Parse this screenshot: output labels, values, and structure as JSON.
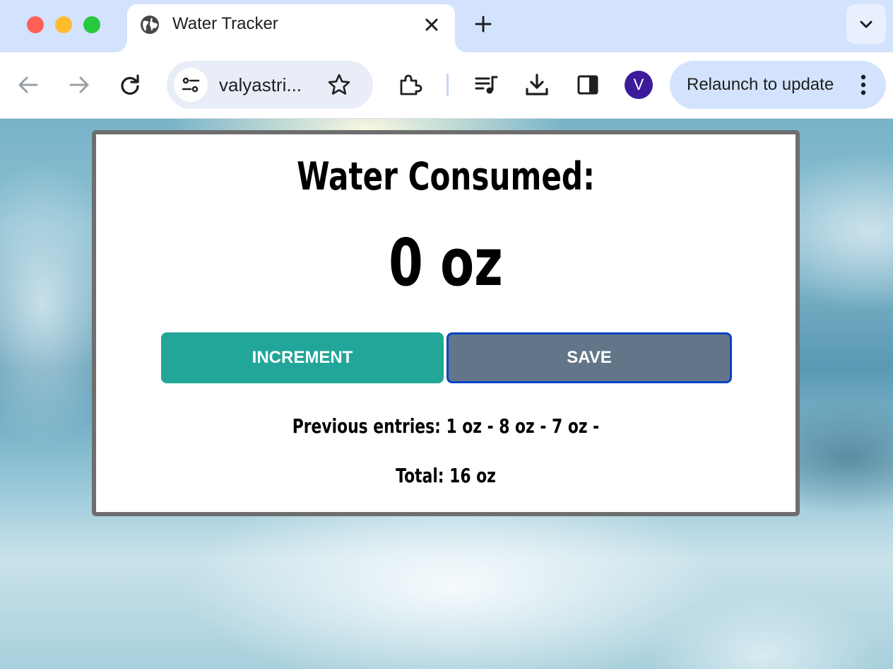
{
  "browser": {
    "tab": {
      "title": "Water Tracker",
      "icon": "globe-icon"
    },
    "omnibox": {
      "url": "valyastri..."
    },
    "profile_initial": "V",
    "relaunch_label": "Relaunch to update"
  },
  "app": {
    "heading": "Water Consumed:",
    "amount": "0 oz",
    "buttons": {
      "increment": "INCREMENT",
      "save": "SAVE"
    },
    "previous_entries": "Previous entries: 1 oz - 8 oz - 7 oz -",
    "total": "Total: 16 oz"
  },
  "colors": {
    "increment_button": "#22a699",
    "save_button": "#627589",
    "save_button_focus_ring": "#0a44c2",
    "tab_strip": "#d3e3fd"
  }
}
